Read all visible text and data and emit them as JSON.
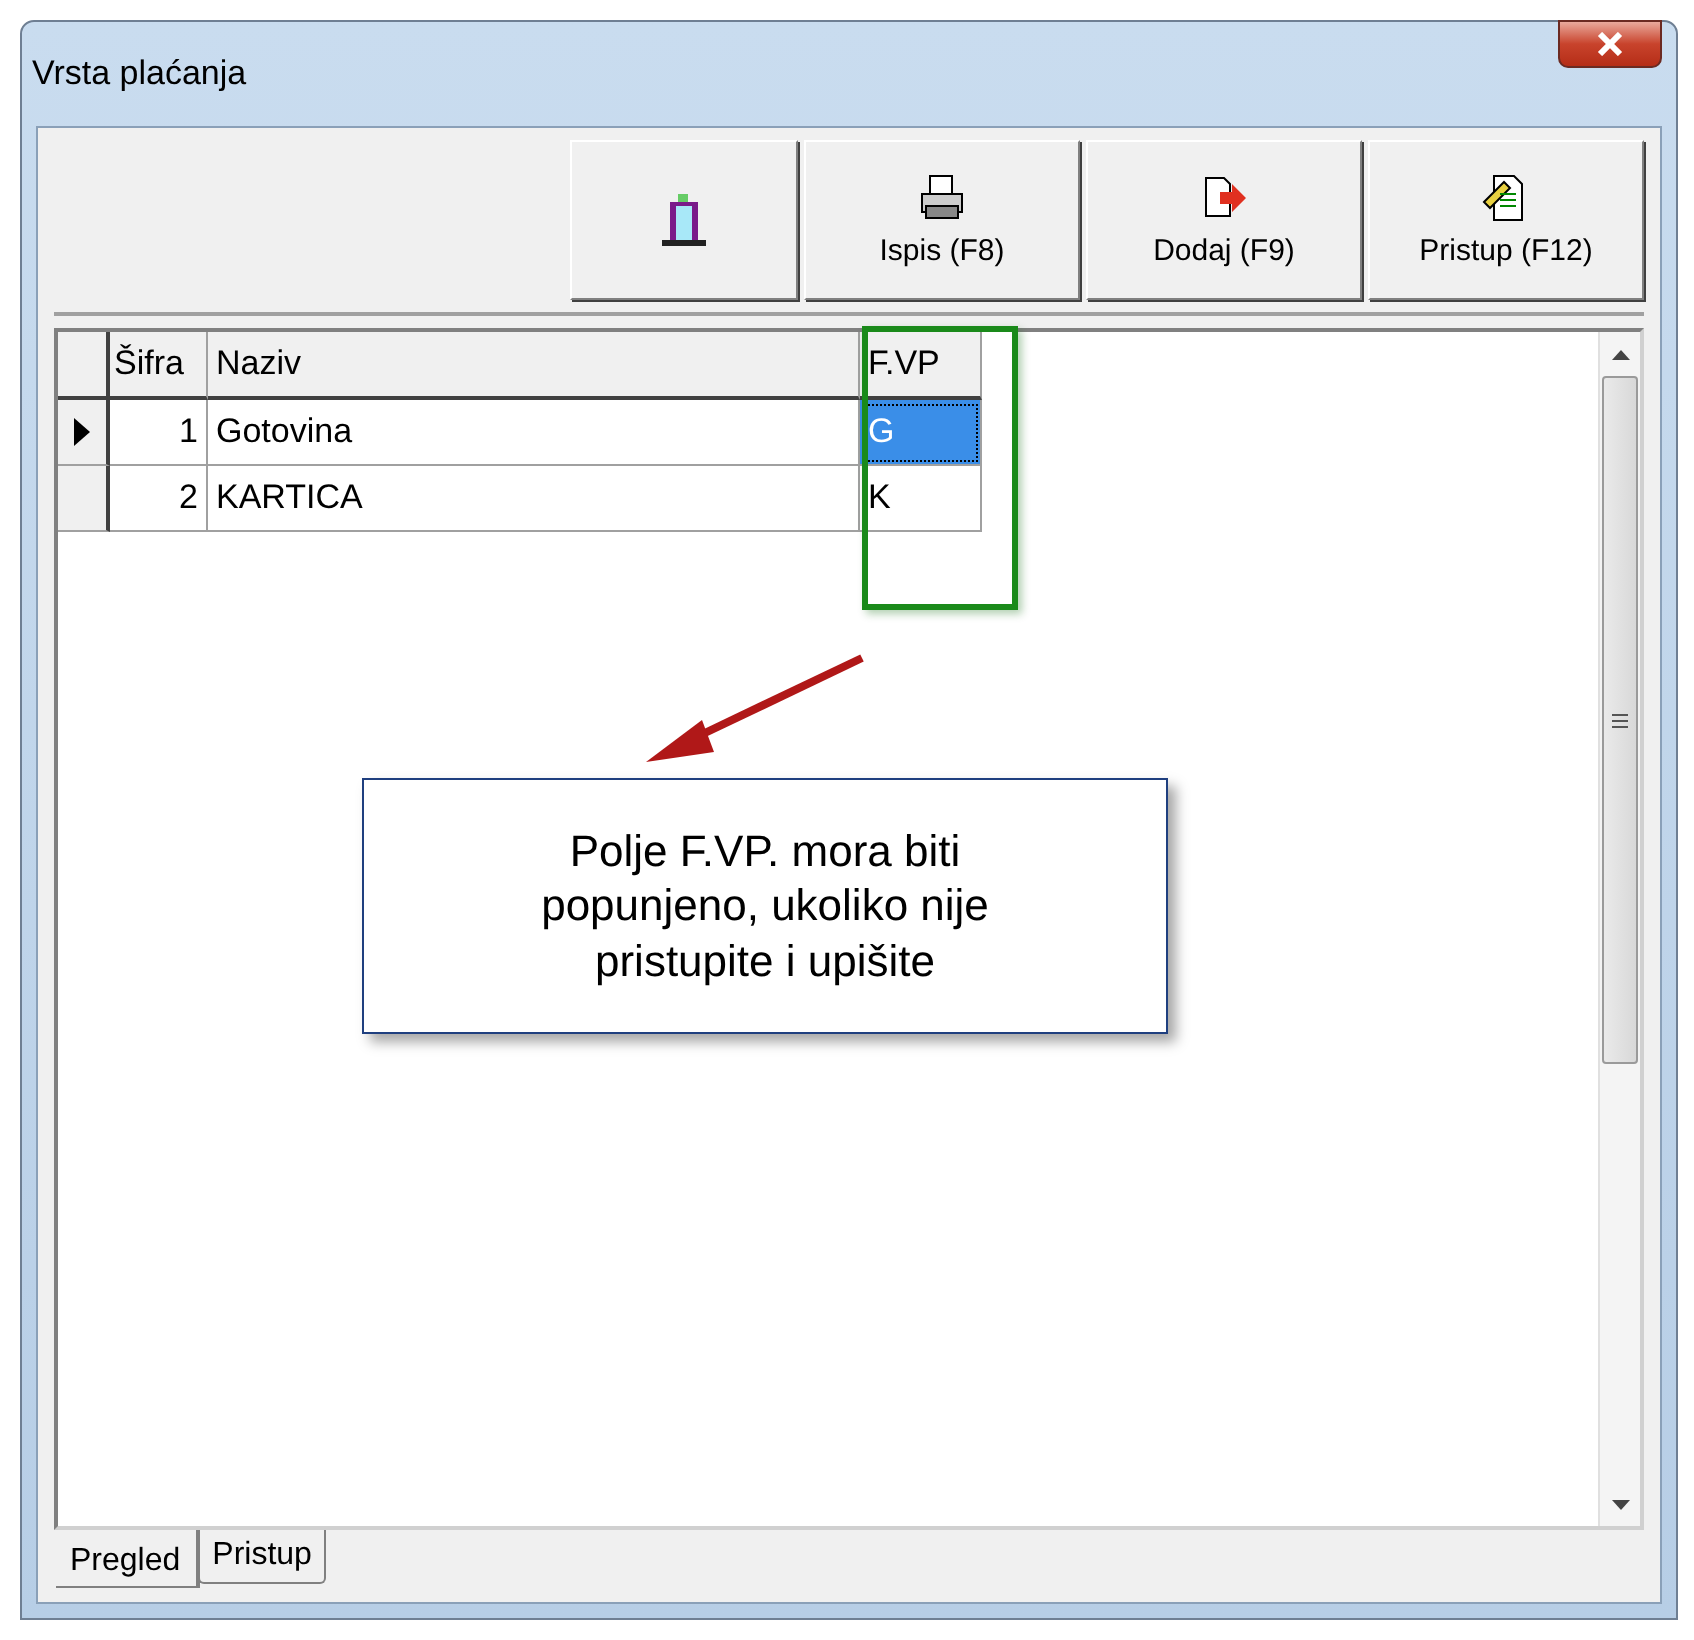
{
  "window": {
    "title": "Vrsta plaćanja"
  },
  "toolbar": {
    "buttons": [
      {
        "kind": "exit"
      },
      {
        "kind": "print",
        "label": "Ispis (F8)"
      },
      {
        "kind": "add",
        "label": "Dodaj (F9)"
      },
      {
        "kind": "access",
        "label": "Pristup (F12)"
      }
    ]
  },
  "table": {
    "columns": [
      "Šifra",
      "Naziv",
      "F.VP"
    ],
    "rows": [
      {
        "cells": [
          "1",
          "Gotovina",
          "G"
        ],
        "selected": true
      },
      {
        "cells": [
          "2",
          "KARTICA",
          "K"
        ],
        "selected": false
      }
    ]
  },
  "annotation": {
    "callout": "Polje F.VP. mora biti popunjeno, ukoliko nije pristupite i upišite"
  },
  "tabs": [
    {
      "label": "Pregled",
      "selected": true
    },
    {
      "label": "Pristup",
      "selected": false
    }
  ]
}
